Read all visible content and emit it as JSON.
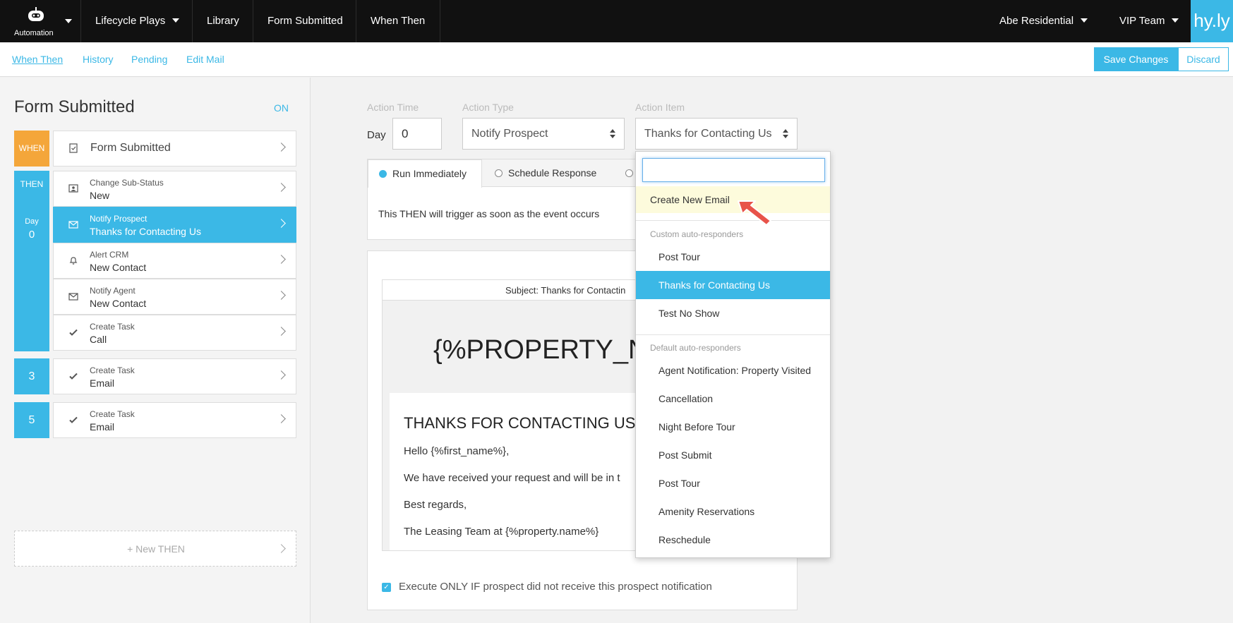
{
  "nav": {
    "brand_label": "Automation",
    "items": [
      "Lifecycle Plays",
      "Library",
      "Form Submitted",
      "When Then"
    ],
    "property": "Abe Residential",
    "team": "VIP Team",
    "logo": "hy.ly"
  },
  "subnav": {
    "links": [
      "When Then",
      "History",
      "Pending",
      "Edit Mail"
    ],
    "save": "Save Changes",
    "discard": "Discard"
  },
  "left": {
    "title": "Form Submitted",
    "status": "ON",
    "when_tag": "WHEN",
    "when_step": "Form Submitted",
    "then_tag": "THEN",
    "day_label": "Day",
    "day_value": "0",
    "steps": [
      {
        "action": "Change Sub-Status",
        "item": "New",
        "icon": "user-card-icon"
      },
      {
        "action": "Notify Prospect",
        "item": "Thanks for Contacting Us",
        "icon": "envelope-icon"
      },
      {
        "action": "Alert CRM",
        "item": "New Contact",
        "icon": "bell-icon"
      },
      {
        "action": "Notify Agent",
        "item": "New Contact",
        "icon": "envelope-icon"
      },
      {
        "action": "Create Task",
        "item": "Call",
        "icon": "check-icon"
      }
    ],
    "later": [
      {
        "day": "3",
        "action": "Create Task",
        "item": "Email"
      },
      {
        "day": "5",
        "action": "Create Task",
        "item": "Email"
      }
    ],
    "new_then": "+ New THEN"
  },
  "main": {
    "action_time_label": "Action Time",
    "action_type_label": "Action Type",
    "action_item_label": "Action Item",
    "day_label": "Day",
    "day_value": "0",
    "action_type": "Notify Prospect",
    "action_item": "Thanks for Contacting Us",
    "tabs": [
      "Run Immediately",
      "Schedule Response"
    ],
    "trigger_text": "This THEN will trigger as soon as the event occurs",
    "email": {
      "subject": "Subject: Thanks for Contactin",
      "property_placeholder": "{%PROPERTY_N",
      "heading": "THANKS FOR CONTACTING US",
      "greeting": "Hello {%first_name%},",
      "body": "We have received your request and will be in t",
      "closing": "Best regards,",
      "signature": "The Leasing Team at {%property.name%}"
    },
    "execute_text": "Execute ONLY IF prospect did not receive this prospect notification"
  },
  "dropdown": {
    "create": "Create New Email",
    "custom_label": "Custom auto-responders",
    "custom": [
      "Post Tour",
      "Thanks for Contacting Us",
      "Test No Show"
    ],
    "default_label": "Default auto-responders",
    "default": [
      "Agent Notification: Property Visited",
      "Cancellation",
      "Night Before Tour",
      "Post Submit",
      "Post Tour",
      "Amenity Reservations",
      "Reschedule"
    ]
  },
  "colors": {
    "accent": "#3bb8e6",
    "when": "#f4a63a",
    "nav_bg": "#111111",
    "pointer": "#e8534a"
  }
}
